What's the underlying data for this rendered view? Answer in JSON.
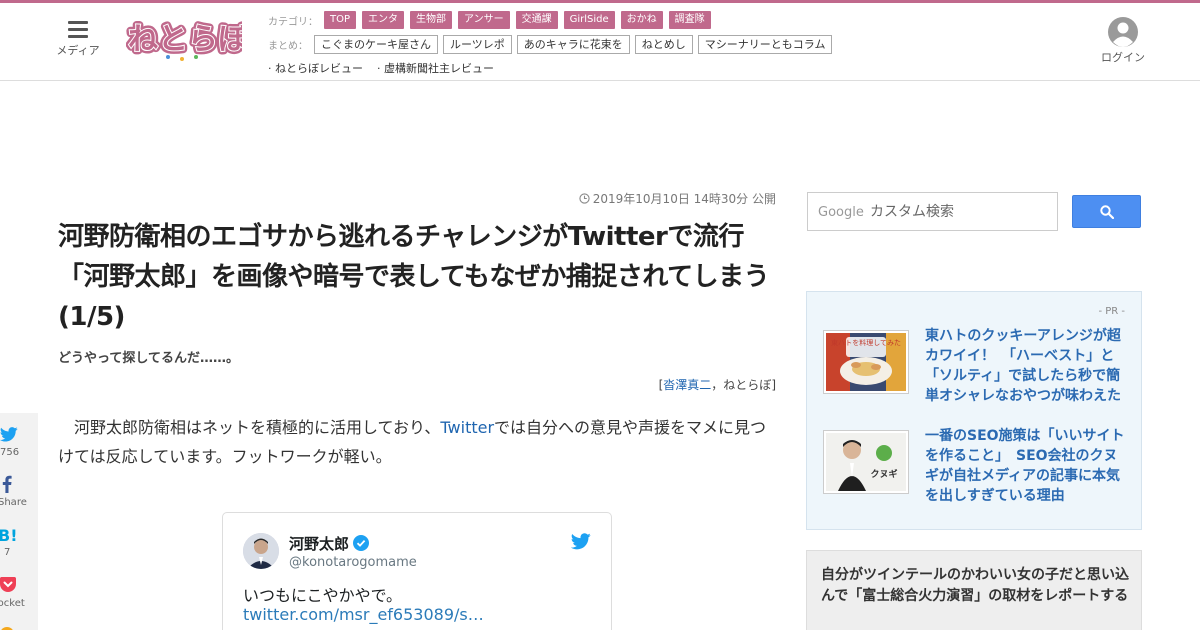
{
  "header": {
    "menu_label": "メディア",
    "logo_text": "ねとらぼ",
    "login_label": "ログイン",
    "category_head": "カテゴリ：",
    "categories": [
      "TOP",
      "エンタ",
      "生物部",
      "アンサー",
      "交通課",
      "GirlSide",
      "おかね",
      "調査隊"
    ],
    "summary_head": "まとめ：",
    "summaries": [
      "こぐまのケーキ屋さん",
      "ルーツレポ",
      "あのキャラに花束を",
      "ねとめし",
      "マシーナリーともコラム"
    ],
    "links": [
      "· ねとらぼレビュー",
      "· 虚構新聞社主レビュー"
    ]
  },
  "article": {
    "pubdate": "2019年10月10日 14時30分 公開",
    "title": "河野防衛相のエゴサから逃れるチャレンジがTwitterで流行　「河野太郎」を画像や暗号で表してもなぜか捕捉されてしまう (1/5)",
    "subtitle": "どうやって探してるんだ……。",
    "byline_open": "[",
    "author": "沓澤真二",
    "byline_sep": "，",
    "byline_site": "ねとらぼ",
    "byline_close": "]",
    "body_pre": "河野太郎防衛相はネットを積極的に活用しており、",
    "body_link": "Twitter",
    "body_post": "では自分への意見や声援をマメに見つけては反応しています。フットワークが軽い。"
  },
  "tweet": {
    "name": "河野太郎",
    "handle": "@konotarogomame",
    "text": "いつもにこやかやで。",
    "link": "twitter.com/msr_ef653089/s…"
  },
  "share": {
    "twitter_count": "756",
    "facebook_label": "Share",
    "hatena_count": "7",
    "pocket_label": "Pocket"
  },
  "sidebar": {
    "search_brand": "Google",
    "search_placeholder": "カスタム検索",
    "pr_label": "- PR -",
    "pr_items": [
      {
        "title": "東ハトのクッキーアレンジが超カワイイ！　「ハーベスト」と「ソルティ」で試したら秒で簡単オシャレなおやつが味わえた",
        "thumb_caption": "東ハトを料理してみた"
      },
      {
        "title": "一番のSEO施策は「いいサイトを作ること」　SEO会社のクヌギが自社メディアの記事に本気を出しすぎている理由",
        "thumb_caption": "クヌギ"
      }
    ],
    "related_title": "自分がツインテールのかわいい女の子だと思い込んで「富士総合火力演習」の取材をレポートする"
  },
  "colors": {
    "brand_pink": "#c0698c",
    "link_blue": "#2066b0",
    "search_blue": "#4d8ff2",
    "twitter_blue": "#1da1f2"
  }
}
